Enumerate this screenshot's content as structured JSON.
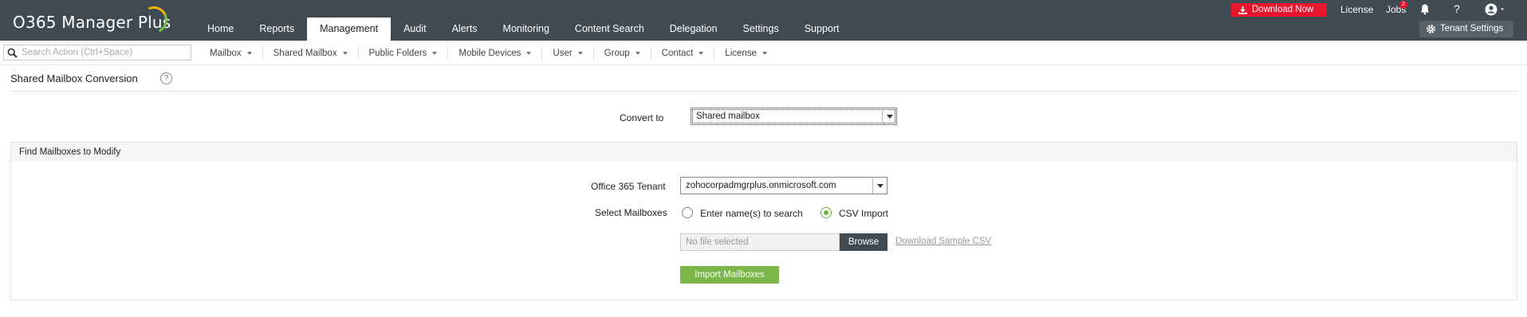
{
  "app": {
    "title": "O365 Manager Plus"
  },
  "topnav": {
    "items": [
      "Home",
      "Reports",
      "Management",
      "Audit",
      "Alerts",
      "Monitoring",
      "Content Search",
      "Delegation",
      "Settings",
      "Support"
    ],
    "active": "Management"
  },
  "topright": {
    "download_label": "Download Now",
    "license_label": "License",
    "jobs_label": "Jobs",
    "jobs_count": "2",
    "help_label": "?",
    "tenant_settings_label": "Tenant Settings"
  },
  "subbar": {
    "search_placeholder": "Search Action (Ctrl+Space)",
    "items": [
      "Mailbox",
      "Shared Mailbox",
      "Public Folders",
      "Mobile Devices",
      "User",
      "Group",
      "Contact",
      "License"
    ]
  },
  "page": {
    "title": "Shared Mailbox Conversion",
    "help_glyph": "?"
  },
  "convert": {
    "label": "Convert to",
    "value": "Shared mailbox"
  },
  "panel": {
    "title": "Find Mailboxes to Modify",
    "tenant_label": "Office 365 Tenant",
    "tenant_value": "zohocorpadmgrplus.onmicrosoft.com",
    "select_label": "Select Mailboxes",
    "radio_enter_label": "Enter name(s) to search",
    "radio_csv_label": "CSV Import",
    "selected_option": "CSV Import",
    "file_placeholder": "No file selected",
    "browse_label": "Browse",
    "sample_link_label": "Download Sample CSV",
    "import_label": "Import Mailboxes"
  },
  "colors": {
    "topbar": "#3f4a53",
    "download": "#e8162c",
    "accent_green": "#7ab648"
  }
}
